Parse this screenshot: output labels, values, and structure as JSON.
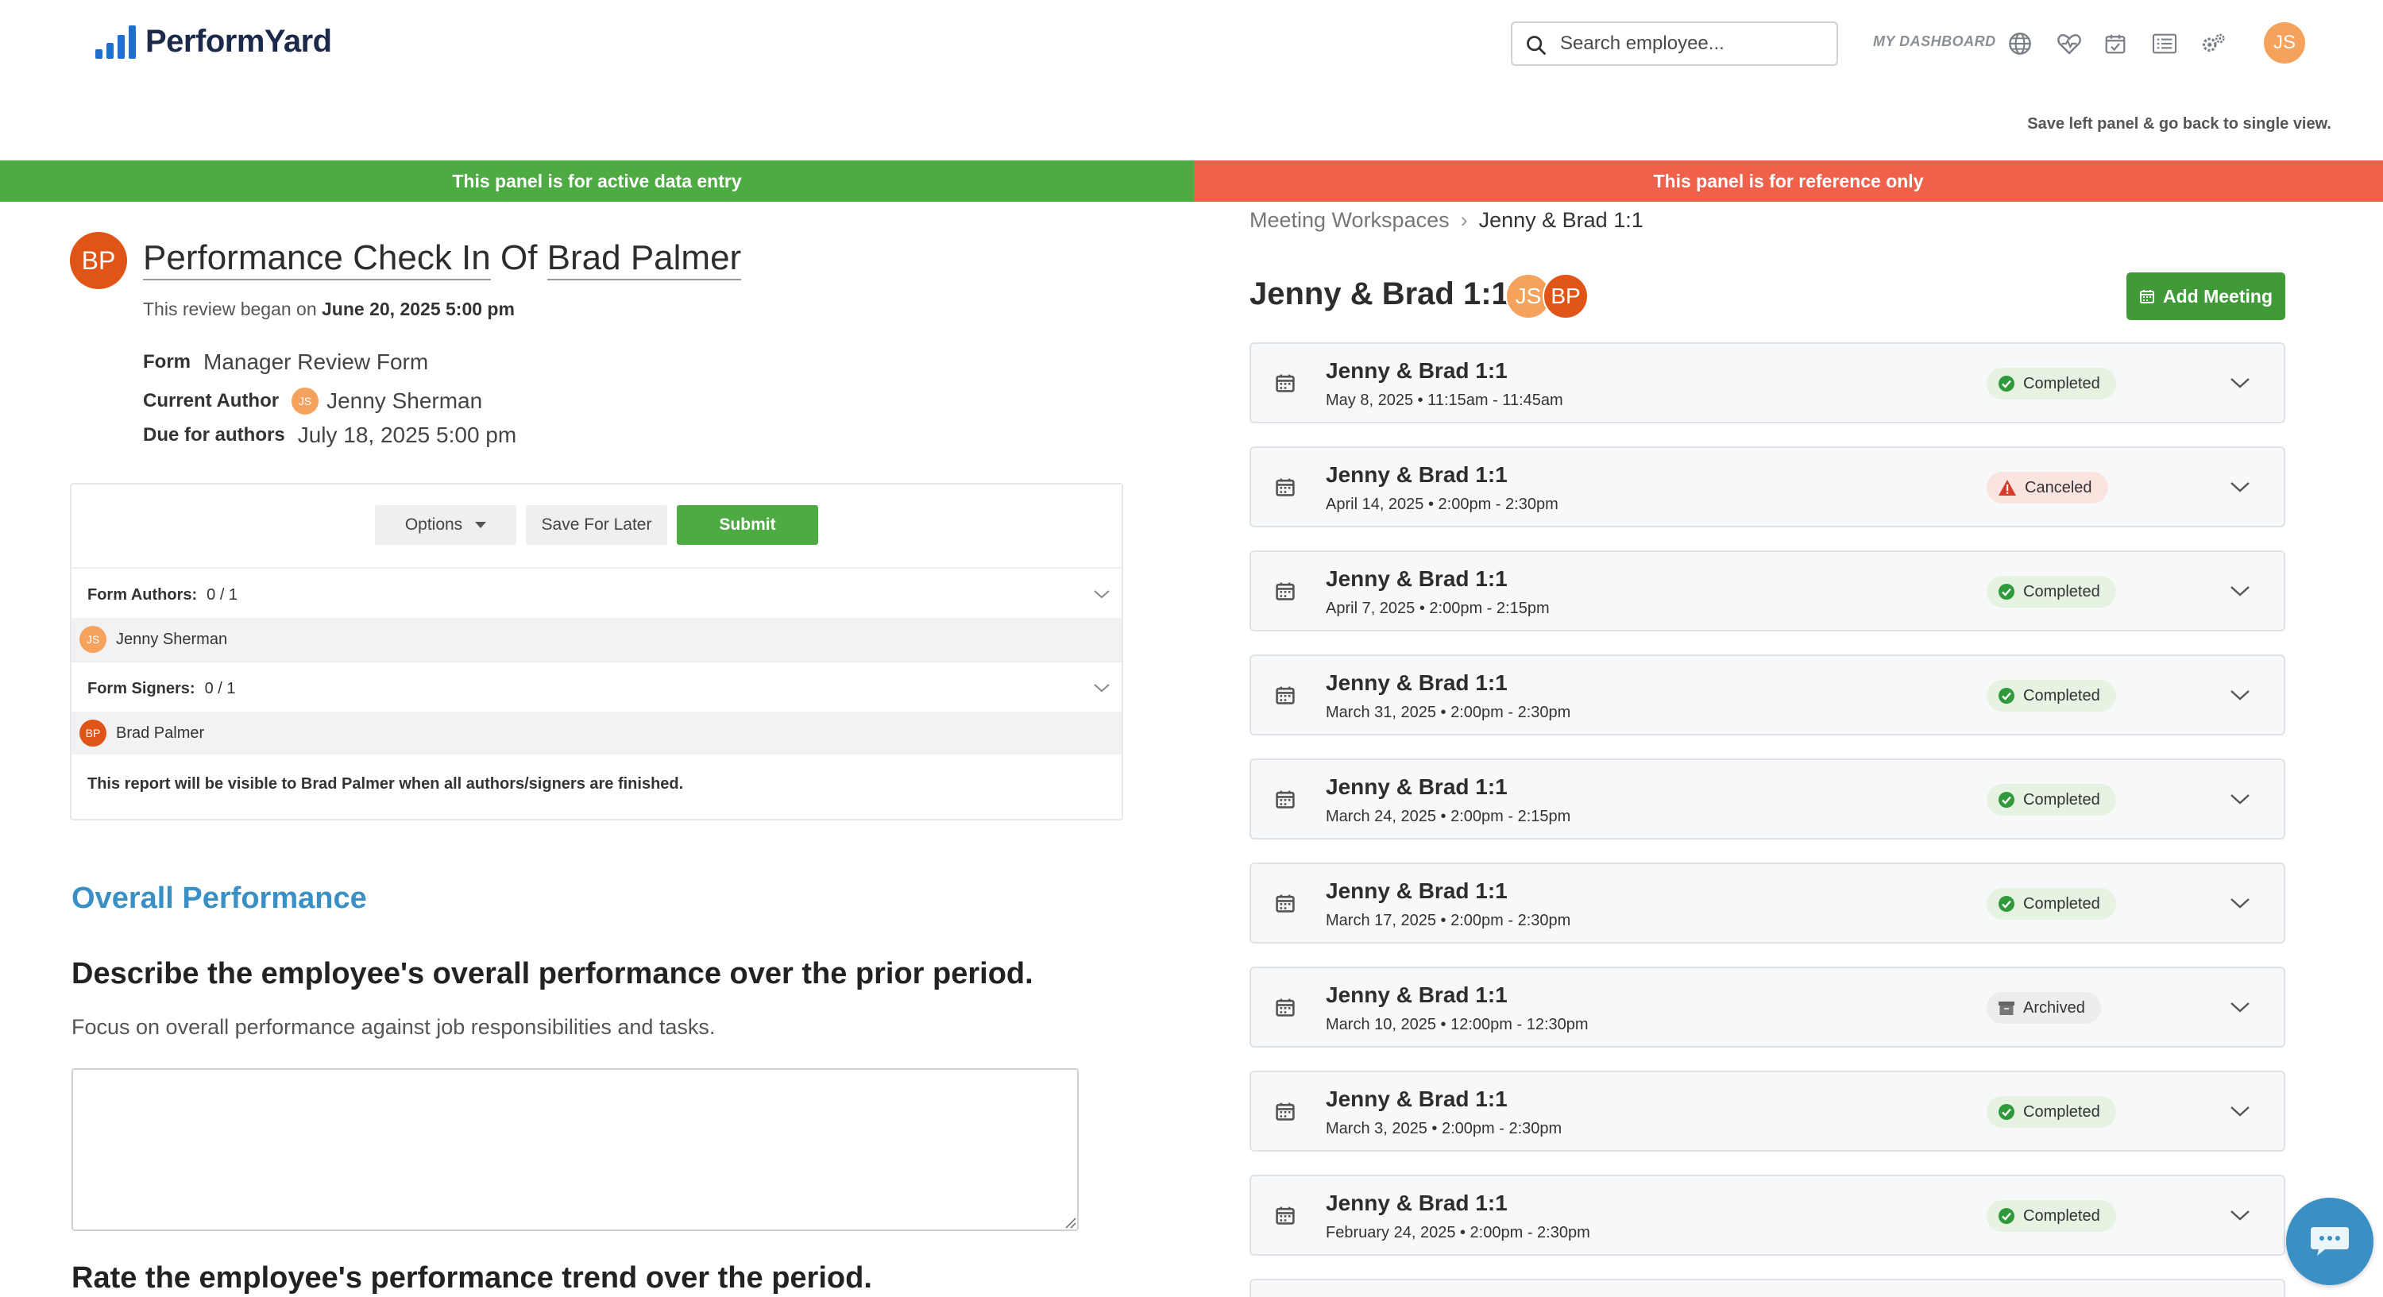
{
  "header": {
    "logo_text": "PerformYard",
    "search_placeholder": "Search employee...",
    "dashboard_label": "MY DASHBOARD",
    "user_initials": "JS",
    "nav_icons": [
      "globe-icon",
      "heart-pulse-icon",
      "calendar-check-icon",
      "list-icon",
      "gears-icon"
    ]
  },
  "save_left_label": "Save left panel & go back to single view.",
  "banners": {
    "left": "This panel is for active data entry",
    "right": "This panel is for reference only"
  },
  "review": {
    "avatar_initials": "BP",
    "title_prefix": "Performance Check In",
    "title_of": "Of",
    "title_name": "Brad Palmer",
    "began_prefix": "This review began on",
    "began_date": "June 20, 2025 5:00 pm",
    "form_label": "Form",
    "form_value": "Manager Review Form",
    "author_label": "Current Author",
    "author_initials": "JS",
    "author_value": "Jenny Sherman",
    "due_label": "Due for authors",
    "due_value": "July 18, 2025 5:00 pm"
  },
  "form_box": {
    "options_label": "Options",
    "save_later_label": "Save For Later",
    "submit_label": "Submit",
    "authors_label": "Form Authors:",
    "authors_count": "0 / 1",
    "author_person_initials": "JS",
    "author_person_name": "Jenny Sherman",
    "signers_label": "Form Signers:",
    "signers_count": "0 / 1",
    "signer_person_initials": "BP",
    "signer_person_name": "Brad Palmer",
    "visibility_note": "This report will be visible to Brad Palmer when all authors/signers are finished."
  },
  "section": {
    "title": "Overall Performance",
    "question1": "Describe the employee's overall performance over the prior period.",
    "question1_help": "Focus on overall performance against job responsibilities and tasks.",
    "answer1": "",
    "question2": "Rate the employee's performance trend over the period."
  },
  "right_panel": {
    "breadcrumb_root": "Meeting Workspaces",
    "breadcrumb_current": "Jenny & Brad 1:1",
    "title": "Jenny & Brad 1:1",
    "avatar1_initials": "JS",
    "avatar2_initials": "BP",
    "add_meeting_label": "Add Meeting",
    "meetings": [
      {
        "title": "Jenny & Brad 1:1",
        "time": "May 8, 2025 • 11:15am - 11:45am",
        "status": "Completed"
      },
      {
        "title": "Jenny & Brad 1:1",
        "time": "April 14, 2025 • 2:00pm - 2:30pm",
        "status": "Canceled"
      },
      {
        "title": "Jenny & Brad 1:1",
        "time": "April 7, 2025 • 2:00pm - 2:15pm",
        "status": "Completed"
      },
      {
        "title": "Jenny & Brad 1:1",
        "time": "March 31, 2025 • 2:00pm - 2:30pm",
        "status": "Completed"
      },
      {
        "title": "Jenny & Brad 1:1",
        "time": "March 24, 2025 • 2:00pm - 2:15pm",
        "status": "Completed"
      },
      {
        "title": "Jenny & Brad 1:1",
        "time": "March 17, 2025 • 2:00pm - 2:30pm",
        "status": "Completed"
      },
      {
        "title": "Jenny & Brad 1:1",
        "time": "March 10, 2025 • 12:00pm - 12:30pm",
        "status": "Archived"
      },
      {
        "title": "Jenny & Brad 1:1",
        "time": "March 3, 2025 • 2:00pm - 2:30pm",
        "status": "Completed"
      },
      {
        "title": "Jenny & Brad 1:1",
        "time": "February 24, 2025 • 2:00pm - 2:30pm",
        "status": "Completed"
      }
    ]
  },
  "colors": {
    "brand_blue": "#1f6fd1",
    "active_green": "#4eab43",
    "reference_red": "#f0614b",
    "section_blue": "#3a8fc4",
    "avatar_orange": "#f5a25d",
    "avatar_red": "#e05418"
  }
}
